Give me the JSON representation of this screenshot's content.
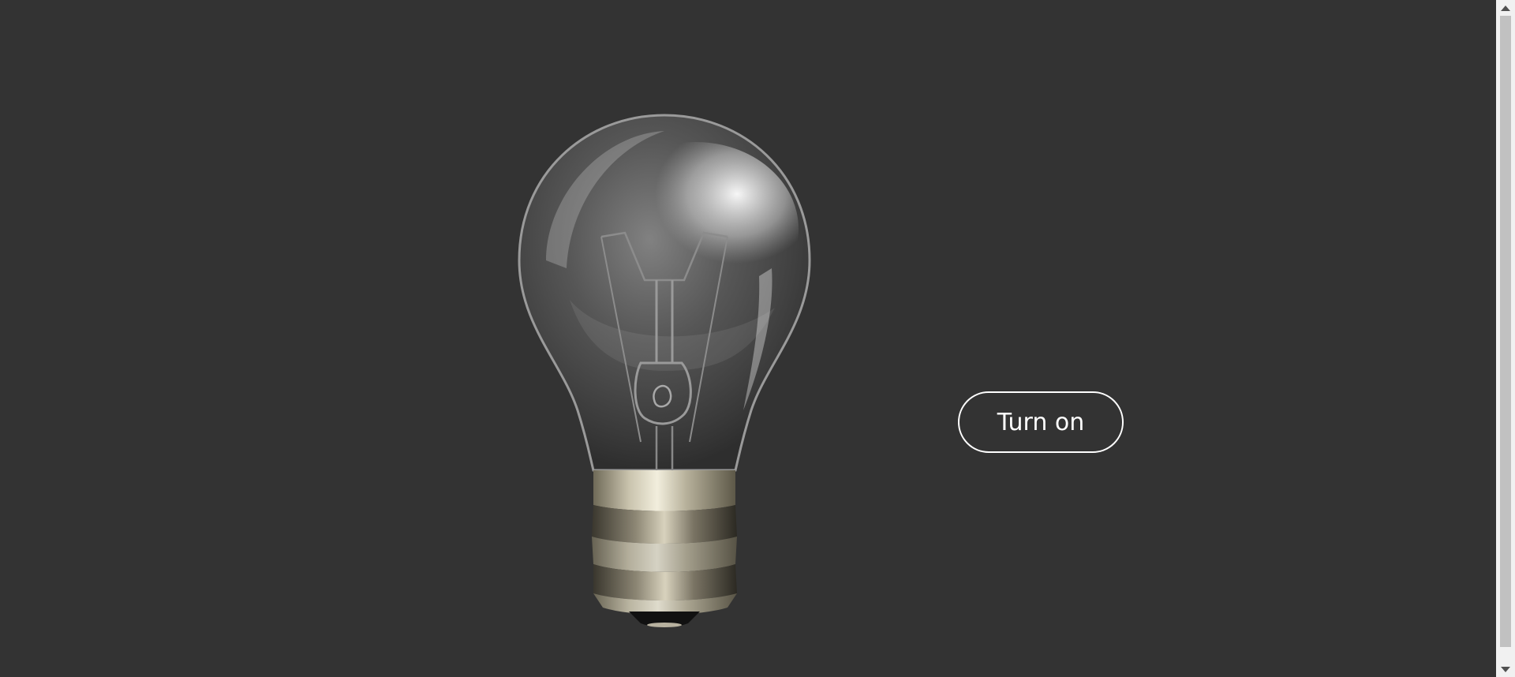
{
  "page": {
    "background": "#333333"
  },
  "bulb": {
    "icon": "light-bulb-off-icon",
    "state": "off"
  },
  "toggle": {
    "label": "Turn on",
    "border_color": "#ffffff",
    "text_color": "#ffffff"
  },
  "scrollbar": {
    "up_icon": "scroll-up-arrow-icon",
    "down_icon": "scroll-down-arrow-icon"
  }
}
